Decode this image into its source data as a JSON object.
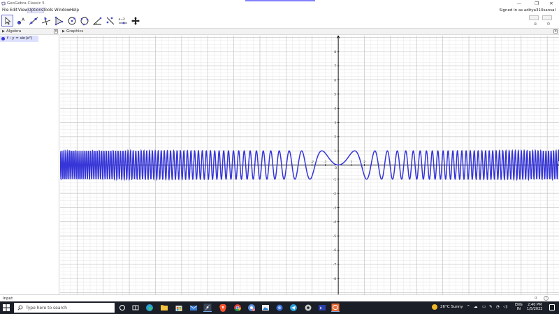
{
  "window": {
    "title": "GeoGebra Classic 5",
    "controls": [
      "—",
      "❐",
      "✕"
    ]
  },
  "menu": {
    "items": [
      "File",
      "Edit",
      "View",
      "Options",
      "Tools",
      "Window",
      "Help"
    ],
    "active_index": 3,
    "signed_in": "Signed in as aditya310sansal"
  },
  "toolbar": {
    "tools": [
      "move",
      "point",
      "line",
      "perpendicular-line",
      "polygon",
      "circle-center-point",
      "circle-three-points",
      "angle",
      "reflect",
      "slider",
      "move-graphics-view"
    ],
    "selected_tool": "move",
    "slider_glyph": "a=2"
  },
  "algebra": {
    "title": "Algebra",
    "entries": [
      {
        "text": "f : y = sin(x²)",
        "color": "#3535d8",
        "visible": true
      }
    ]
  },
  "graphics": {
    "title": "Graphics"
  },
  "chart_data": {
    "type": "line",
    "function": "y = sin(x^2)",
    "series": [
      {
        "name": "f",
        "color": "#3535d8",
        "expression": "sin(x^2)"
      }
    ],
    "xlim": [
      -21.3,
      16.9
    ],
    "ylim": [
      -9.13,
      9.13
    ],
    "y_ticks": [
      -8,
      -7,
      -6,
      -5,
      -4,
      -3,
      -2,
      -1,
      1,
      2,
      3,
      4,
      5,
      6,
      7,
      8
    ],
    "x_ticks_visible": [
      -2,
      -1,
      1,
      2
    ],
    "grid": true,
    "axis_color": "#000000"
  },
  "input_bar": {
    "label": "Input",
    "value": "",
    "symbol": "α",
    "help": "?"
  },
  "taskbar": {
    "search_placeholder": "Type here to search",
    "apps": [
      "task-view",
      "edge",
      "file-explorer",
      "store",
      "mail",
      "geogebra",
      "brave",
      "chrome",
      "chrome-profile",
      "photos",
      "app-1",
      "telegram",
      "settings",
      "terminal",
      "geogebra-classic"
    ],
    "weather": "26°C  Sunny",
    "language": [
      "ENG",
      "IN"
    ],
    "time": "2:40 PM",
    "date": "1/5/2022"
  }
}
